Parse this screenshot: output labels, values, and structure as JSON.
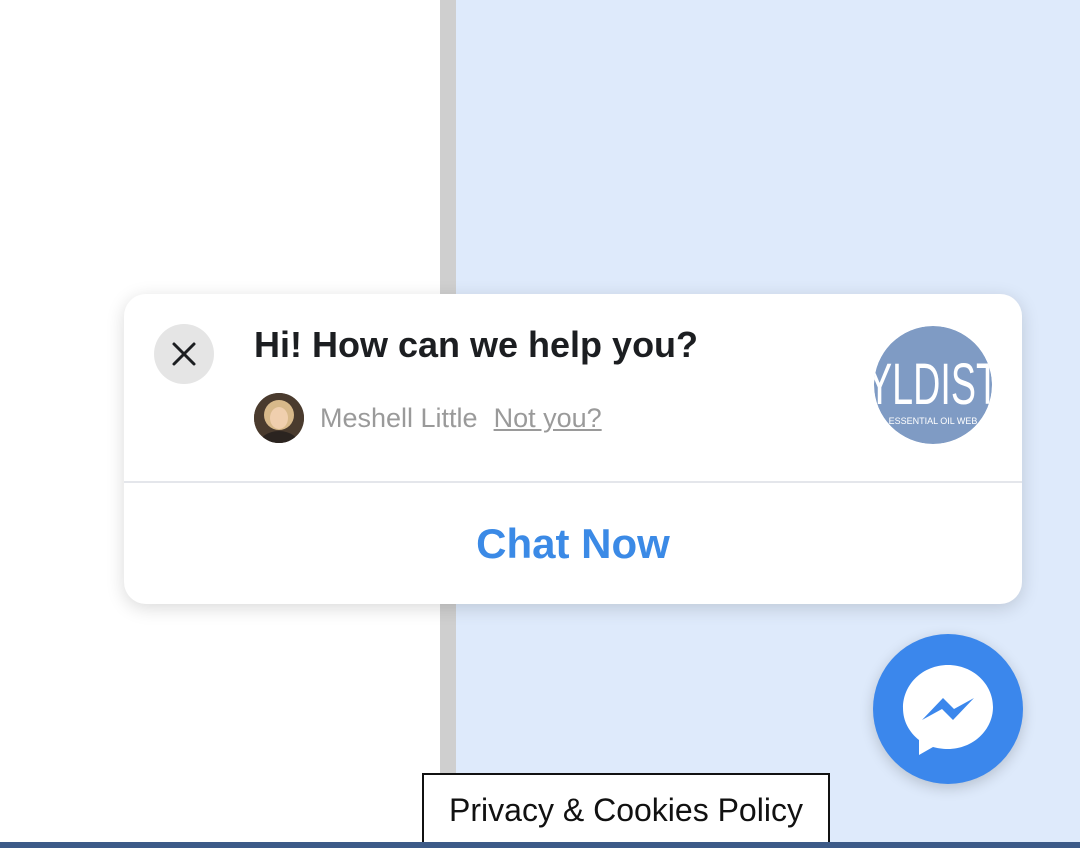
{
  "chat_popup": {
    "greeting": "Hi! How can we help you?",
    "user_name": "Meshell Little",
    "not_you_link": "Not you?",
    "chat_now_button": "Chat Now",
    "brand_logo_text": "YLDIST",
    "brand_logo_subtext": "ESSENTIAL OIL WEB",
    "close_icon": "close-icon"
  },
  "messenger_button": {
    "icon": "messenger-icon",
    "color": "#3b87ec"
  },
  "privacy_tab": {
    "label": "Privacy & Cookies Policy"
  },
  "colors": {
    "accent": "#3b8ae6",
    "right_panel_bg": "#deeafb",
    "divider": "#cfcfcf"
  }
}
